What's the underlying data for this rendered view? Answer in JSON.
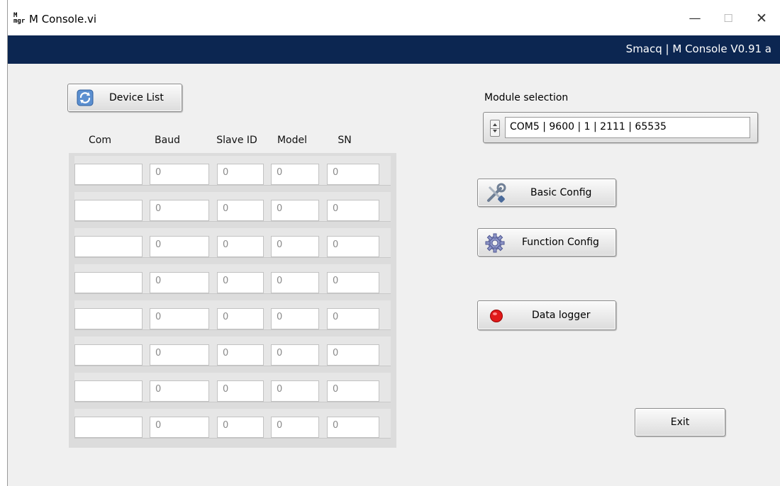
{
  "window": {
    "icon_text_top": "M",
    "icon_text_bottom": "mgr",
    "title": "M Console.vi",
    "minimize_glyph": "—",
    "maximize_glyph": "☐",
    "close_glyph": "✕"
  },
  "header": {
    "brand": "Smacq | M Console V0.91 a"
  },
  "device_list_button": {
    "label": "Device List",
    "icon": "refresh-icon"
  },
  "table": {
    "columns": [
      "Com",
      "Baud",
      "Slave ID",
      "Model",
      "SN"
    ],
    "rows": [
      [
        "",
        "0",
        "0",
        "0",
        "0"
      ],
      [
        "",
        "0",
        "0",
        "0",
        "0"
      ],
      [
        "",
        "0",
        "0",
        "0",
        "0"
      ],
      [
        "",
        "0",
        "0",
        "0",
        "0"
      ],
      [
        "",
        "0",
        "0",
        "0",
        "0"
      ],
      [
        "",
        "0",
        "0",
        "0",
        "0"
      ],
      [
        "",
        "0",
        "0",
        "0",
        "0"
      ],
      [
        "",
        "0",
        "0",
        "0",
        "0"
      ]
    ]
  },
  "module": {
    "label": "Module selection",
    "value": "COM5 | 9600 | 1 | 2111 | 65535"
  },
  "buttons": {
    "basic_config": {
      "label": "Basic Config",
      "icon": "tools-icon"
    },
    "function_config": {
      "label": "Function Config",
      "icon": "gear-icon"
    },
    "data_logger": {
      "label": "Data logger",
      "icon": "record-icon",
      "indicator_color": "#e01a1a"
    },
    "exit": {
      "label": "Exit"
    }
  },
  "colors": {
    "header_bar": "#0c2651",
    "panel": "#f0f0f0"
  }
}
